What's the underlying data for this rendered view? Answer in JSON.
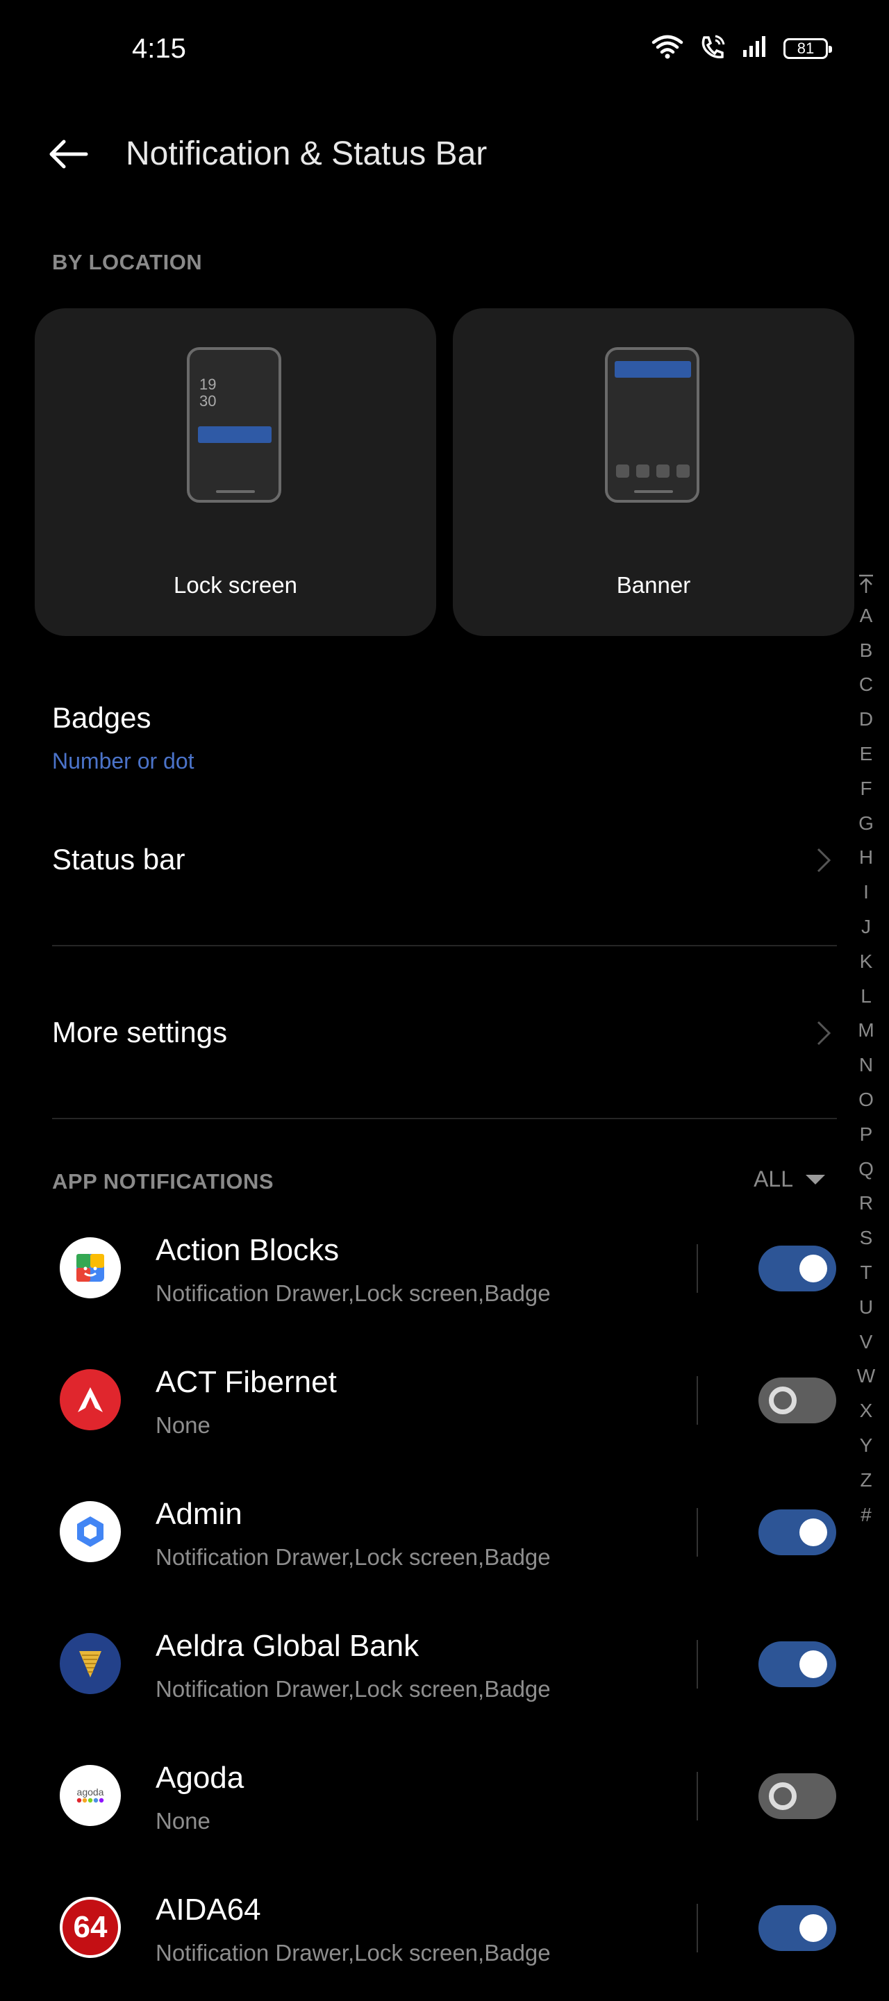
{
  "status_bar": {
    "time": "4:15",
    "battery": "81",
    "icons": [
      "wifi-icon",
      "wifi-calling-icon",
      "signal-icon",
      "battery-icon"
    ]
  },
  "header": {
    "title": "Notification & Status Bar"
  },
  "by_location": {
    "heading": "BY LOCATION",
    "lock_card": {
      "label": "Lock screen",
      "time_line1": "19",
      "time_line2": "30"
    },
    "banner_card": {
      "label": "Banner"
    }
  },
  "settings": {
    "badges": {
      "title": "Badges",
      "value": "Number or dot"
    },
    "status_bar": {
      "title": "Status bar"
    },
    "more_settings": {
      "title": "More settings"
    }
  },
  "app_notifications": {
    "heading": "APP NOTIFICATIONS",
    "filter": "ALL",
    "apps": [
      {
        "name": "Action Blocks",
        "sub": "Notification Drawer,Lock screen,Badge",
        "enabled": true,
        "icon": "action-blocks-icon"
      },
      {
        "name": "ACT Fibernet",
        "sub": "None",
        "enabled": false,
        "icon": "act-fibernet-icon"
      },
      {
        "name": "Admin",
        "sub": "Notification Drawer,Lock screen,Badge",
        "enabled": true,
        "icon": "admin-icon"
      },
      {
        "name": "Aeldra Global Bank",
        "sub": "Notification Drawer,Lock screen,Badge",
        "enabled": true,
        "icon": "aeldra-icon"
      },
      {
        "name": "Agoda",
        "sub": "None",
        "enabled": false,
        "icon": "agoda-icon",
        "icon_text": "agoda"
      },
      {
        "name": "AIDA64",
        "sub": "Notification Drawer,Lock screen,Badge",
        "enabled": true,
        "icon": "aida64-icon",
        "icon_text": "64"
      }
    ]
  },
  "alpha_index": [
    "A",
    "B",
    "C",
    "D",
    "E",
    "F",
    "G",
    "H",
    "I",
    "J",
    "K",
    "L",
    "M",
    "N",
    "O",
    "P",
    "Q",
    "R",
    "S",
    "T",
    "U",
    "V",
    "W",
    "X",
    "Y",
    "Z",
    "#"
  ],
  "colors": {
    "background": "#000000",
    "card": "#1d1d1d",
    "accent": "#2d5596",
    "accent_text": "#4b73c9",
    "toggle_off": "#5e5e5e"
  }
}
